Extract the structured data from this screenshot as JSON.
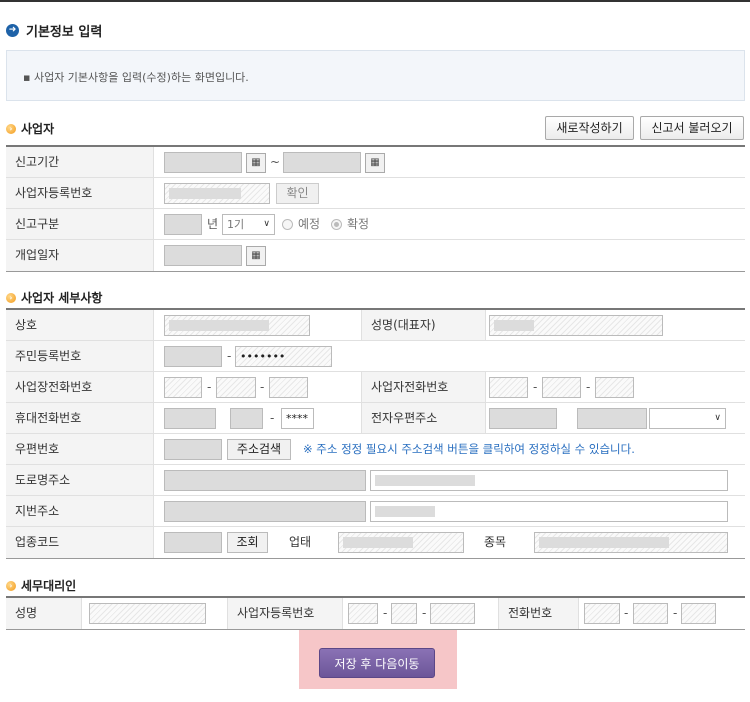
{
  "page": {
    "title": "기본정보 입력",
    "info": "사업자 기본사항을 입력(수정)하는 화면입니다."
  },
  "business": {
    "heading": "사업자",
    "new_button": "새로작성하기",
    "load_button": "신고서 불러오기",
    "labels": {
      "period": "신고기간",
      "reg_no": "사업자등록번호",
      "report_type": "신고구분",
      "open_date": "개업일자"
    },
    "period_sep": "~",
    "confirm_button": "확인",
    "year_unit": "년",
    "term_select": "1기",
    "radio_planned": "예정",
    "radio_final": "확정",
    "radio_selected": "확정"
  },
  "detail": {
    "heading": "사업자 세부사항",
    "labels": {
      "company": "상호",
      "ceo": "성명(대표자)",
      "resident_no": "주민등록번호",
      "biz_phone": "사업장전화번호",
      "biz_tel": "사업자전화번호",
      "mobile": "휴대전화번호",
      "email": "전자우편주소",
      "postcode": "우편번호",
      "road_addr": "도로명주소",
      "lot_addr": "지번주소",
      "industry_code": "업종코드",
      "biz_type": "업태",
      "biz_item": "종목"
    },
    "resident_masked": "•••••••",
    "mobile_masked": "****",
    "dash": "-",
    "address_search_button": "주소검색",
    "address_note": "※ 주소 정정 필요시 주소검색 버튼을 클릭하여 정정하실 수 있습니다.",
    "lookup_button": "조회"
  },
  "agent": {
    "heading": "세무대리인",
    "labels": {
      "name": "성명",
      "reg_no": "사업자등록번호",
      "phone": "전화번호"
    },
    "dash": "-"
  },
  "save_button": "저장 후 다음이동",
  "icons": {
    "title": "arrow-circle-icon",
    "section": "orange-ball-icon",
    "calendar": "calendar-icon"
  },
  "colors": {
    "title_icon": "#1e62a8",
    "section_icon": "#f39a1a",
    "save_button": "#6c5599",
    "note_text": "#2a6fc0"
  }
}
